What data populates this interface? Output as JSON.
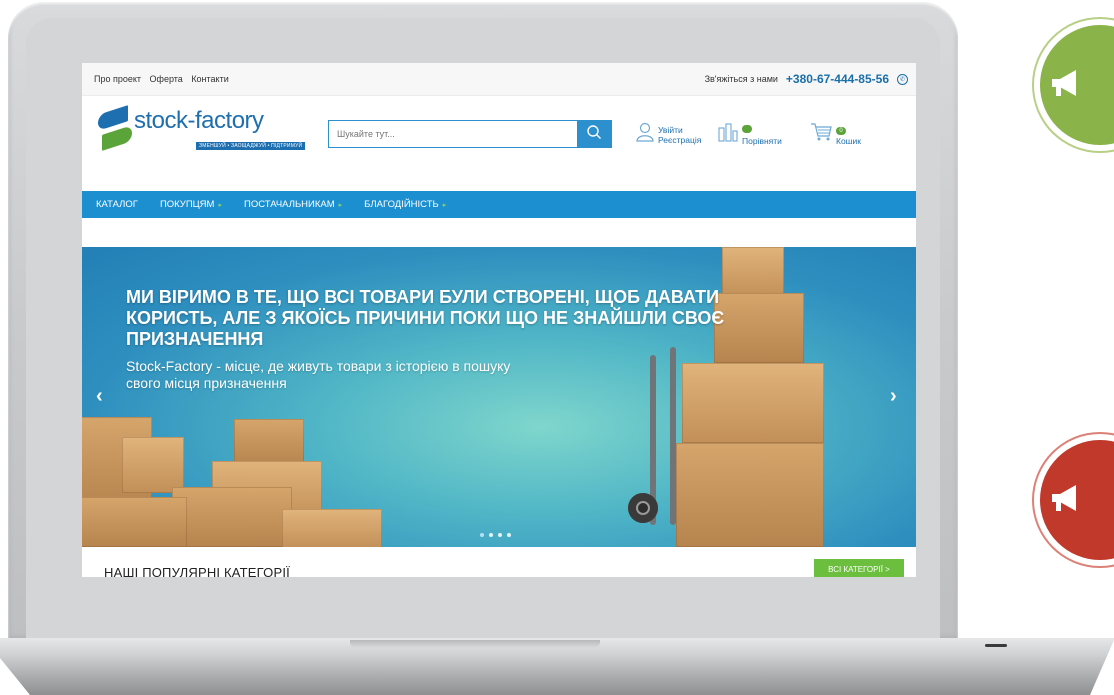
{
  "topbar": {
    "links": [
      "Про проект",
      "Оферта",
      "Контакти"
    ],
    "contact_label": "Зв'яжіться з нами",
    "phone": "+380-67-444-85-56"
  },
  "logo": {
    "name": "stock-factory",
    "slogan": "ЗМЕНШУЙ • ЗАОЩАДЖУЙ • ПІДТРИМУЙ"
  },
  "search": {
    "placeholder": "Шукайте тут..."
  },
  "header": {
    "login": "Увійти",
    "register": "Реєстрація",
    "compare": "Порівняти",
    "compare_count": "",
    "cart": "Кошик",
    "cart_count": "0"
  },
  "nav": {
    "items": [
      {
        "label": "КАТАЛОГ"
      },
      {
        "label": "ПОКУПЦЯМ"
      },
      {
        "label": "ПОСТАЧАЛЬНИКАМ"
      },
      {
        "label": "БЛАГОДІЙНІСТЬ"
      }
    ]
  },
  "banner": {
    "title": "МИ ВІРИМО В ТЕ, ЩО ВСІ ТОВАРИ БУЛИ СТВОРЕНІ, ЩОБ ДАВАТИ КОРИСТЬ, АЛЕ З ЯКОЇСЬ ПРИЧИНИ ПОКИ ЩО НЕ ЗНАЙШЛИ СВОЄ ПРИЗНАЧЕННЯ",
    "subtitle": "Stock-Factory - місце, де живуть товари з історією в пошуку свого місця призначення",
    "slides": 4,
    "active_slide": 1
  },
  "popular": {
    "heading": "НАШІ ПОПУЛЯРНІ КАТЕГОРІЇ",
    "all_button": "ВСІ КАТЕГОРІЇ >"
  },
  "colors": {
    "brand_blue": "#1e6fb0",
    "nav_blue": "#1b8fd0",
    "brand_green": "#5ba43a",
    "circle_green": "#8ab34a",
    "circle_red": "#c0392b"
  },
  "icons": [
    "user-icon",
    "compare-icon",
    "cart-icon",
    "search-icon",
    "megaphone-icon"
  ]
}
